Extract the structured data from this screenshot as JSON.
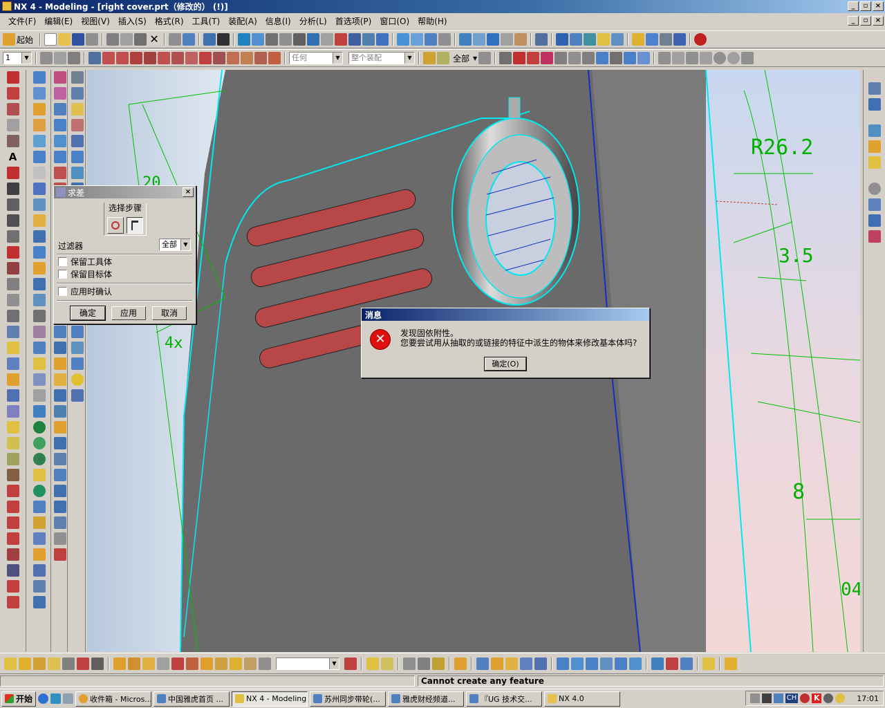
{
  "window": {
    "title": "NX 4 - Modeling - [right cover.prt（修改的） (!)]"
  },
  "menu": [
    "文件(F)",
    "编辑(E)",
    "视图(V)",
    "插入(S)",
    "格式(R)",
    "工具(T)",
    "装配(A)",
    "信息(I)",
    "分析(L)",
    "首选项(P)",
    "窗口(O)",
    "帮助(H)"
  ],
  "toolbar1": {
    "start_label": "起始"
  },
  "toolbar2": {
    "layer_value": "1",
    "filter1": "任何",
    "filter2": "整个装配",
    "filter3": "全部"
  },
  "viewport": {
    "dim_r": "R26.2",
    "dim_35": "3.5",
    "dim_4x": "4x",
    "dim_20": "20",
    "dim_8": "8",
    "dim_04": "04",
    "colors": {
      "body": "#6e6e6e",
      "edge": "#00e8f0",
      "rib": "#b84848",
      "sketch": "#00c000"
    }
  },
  "dialog_subtract": {
    "title": "求差",
    "steps_label": "选择步骤",
    "filter_label": "过滤器",
    "filter_value": "全部",
    "keep_tool": "保留工具体",
    "keep_target": "保留目标体",
    "confirm_apply": "应用时确认",
    "ok": "确定",
    "apply": "应用",
    "cancel": "取消"
  },
  "dialog_message": {
    "title": "消息",
    "line1": "发现固依附性。",
    "line2": "您要尝试用从抽取的或链接的特征中派生的物体来修改基本体吗?",
    "ok": "确定(O)",
    "icon": "error-icon"
  },
  "status": {
    "text": "Cannot create any feature"
  },
  "taskbar": {
    "start": "开始",
    "tasks": [
      "收件箱 - Micros...",
      "中国雅虎首页 ...",
      "NX 4 - Modeling...",
      "苏州同步带轮(...",
      "雅虎财经频道...",
      "『UG 技术交...",
      "NX 4.0"
    ],
    "tray_ime": "CH",
    "clock": "17:01"
  }
}
